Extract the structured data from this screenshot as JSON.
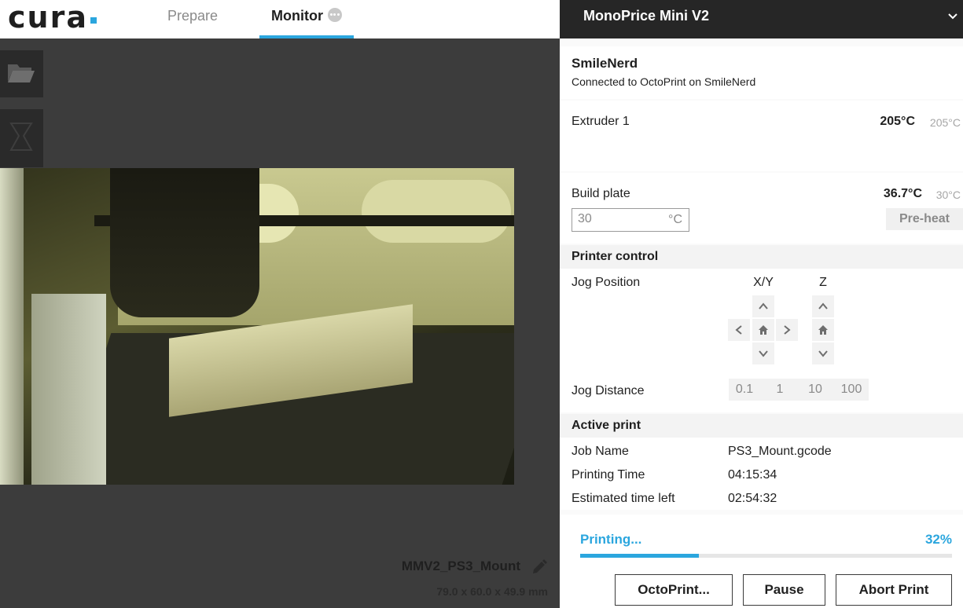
{
  "app": {
    "logo_text": "cura",
    "tabs": [
      {
        "label": "Prepare",
        "active": false
      },
      {
        "label": "Monitor",
        "active": true
      }
    ],
    "accent_color": "#2ba6de"
  },
  "model": {
    "name": "MMV2_PS3_Mount",
    "dimensions": "79.0 x 60.0 x 49.9 mm"
  },
  "printer": {
    "name": "MonoPrice Mini V2",
    "connection_name": "SmileNerd",
    "connection_status": "Connected to OctoPrint on SmileNerd"
  },
  "extruder": {
    "label": "Extruder 1",
    "current": "205°C",
    "target": "205°C"
  },
  "build_plate": {
    "label": "Build plate",
    "current": "36.7°C",
    "target": "30°C",
    "input_value": "30",
    "input_unit": "°C",
    "preheat_label": "Pre-heat"
  },
  "printer_control": {
    "title": "Printer control",
    "jog_position_label": "Jog Position",
    "xy_label": "X/Y",
    "z_label": "Z",
    "jog_distance_label": "Jog Distance",
    "distances": [
      "0.1",
      "1",
      "10",
      "100"
    ]
  },
  "active_print": {
    "title": "Active print",
    "rows": [
      {
        "label": "Job Name",
        "value": "PS3_Mount.gcode"
      },
      {
        "label": "Printing Time",
        "value": "04:15:34"
      },
      {
        "label": "Estimated time left",
        "value": "02:54:32"
      }
    ]
  },
  "progress": {
    "status": "Printing...",
    "percent_text": "32%",
    "fraction": 0.32
  },
  "actions": {
    "octoprint": "OctoPrint...",
    "pause": "Pause",
    "abort": "Abort Print"
  },
  "icons": [
    "folder-icon",
    "flask-icon",
    "pencil-icon",
    "chevron-down-icon",
    "status-dots-icon",
    "home-icon",
    "arrow-up-icon",
    "arrow-down-icon",
    "arrow-left-icon",
    "arrow-right-icon"
  ]
}
